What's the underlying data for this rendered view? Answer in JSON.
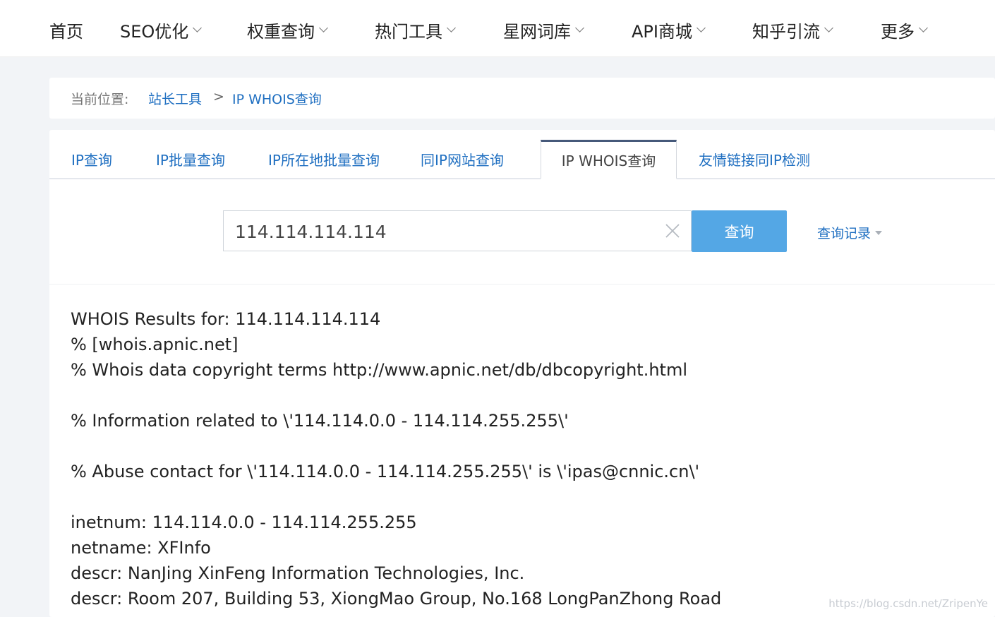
{
  "nav": {
    "items": [
      {
        "label": "首页",
        "dropdown": false
      },
      {
        "label": "SEO优化",
        "dropdown": true
      },
      {
        "label": "权重查询",
        "dropdown": true
      },
      {
        "label": "热门工具",
        "dropdown": true
      },
      {
        "label": "星网词库",
        "dropdown": true
      },
      {
        "label": "API商城",
        "dropdown": true
      },
      {
        "label": "知乎引流",
        "dropdown": true
      },
      {
        "label": "更多",
        "dropdown": true
      }
    ]
  },
  "breadcrumb": {
    "prefix": "当前位置:",
    "items": [
      "站长工具",
      "IP WHOIS查询"
    ],
    "separator": ">"
  },
  "tabs": [
    {
      "label": "IP查询",
      "active": false
    },
    {
      "label": "IP批量查询",
      "active": false
    },
    {
      "label": "IP所在地批量查询",
      "active": false
    },
    {
      "label": "同IP网站查询",
      "active": false
    },
    {
      "label": "IP WHOIS查询",
      "active": true
    },
    {
      "label": "友情链接同IP检测",
      "active": false
    }
  ],
  "search": {
    "value": "114.114.114.114",
    "button_label": "查询",
    "history_label": "查询记录"
  },
  "results": {
    "lines": [
      "WHOIS Results for: 114.114.114.114",
      "% [whois.apnic.net]",
      "% Whois data copyright terms http://www.apnic.net/db/dbcopyright.html",
      "",
      "% Information related to \\'114.114.0.0 - 114.114.255.255\\'",
      "",
      "% Abuse contact for \\'114.114.0.0 - 114.114.255.255\\' is \\'ipas@cnnic.cn\\'",
      "",
      "inetnum: 114.114.0.0 - 114.114.255.255",
      "netname: XFInfo",
      "descr: NanJing XinFeng Information Technologies, Inc.",
      "descr: Room 207, Building 53, XiongMao Group, No.168 LongPanZhong Road"
    ]
  },
  "watermark": "https://blog.csdn.net/ZripenYe",
  "colors": {
    "link": "#1f6fc1",
    "button": "#54a7e5",
    "active_tab_border": "#46597a",
    "page_bg": "#f2f4f7"
  }
}
